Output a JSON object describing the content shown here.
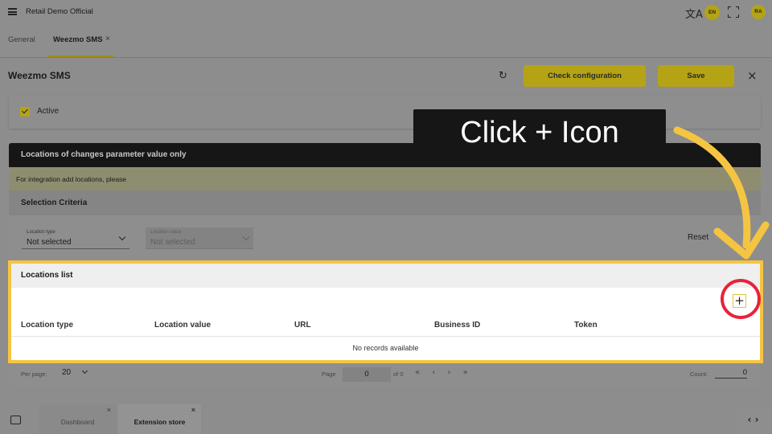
{
  "topbar": {
    "app_title": "Retail Demo Official",
    "translate_icon": "translate-icon",
    "language": "EN",
    "user_initials": "RA"
  },
  "tabs": [
    {
      "label": "General"
    },
    {
      "label": "Weezmo SMS",
      "active": true,
      "close": "×"
    }
  ],
  "header": {
    "title": "Weezmo SMS",
    "check_button": "Check configuration",
    "save_button": "Save",
    "close": "×"
  },
  "active_card": {
    "label": "Active",
    "checked": true
  },
  "locations_section": {
    "title": "Locations of changes parameter value only",
    "info": "For integration add locations, please",
    "selection_criteria": "Selection Criteria",
    "location_type": {
      "label": "Location type",
      "value": "Not selected"
    },
    "location_value": {
      "label": "Location value",
      "value": "Not selected",
      "disabled": true
    },
    "reset": "Reset"
  },
  "locations_list": {
    "title": "Locations list",
    "add_icon": "+",
    "columns": [
      "Location type",
      "Location value",
      "URL",
      "Business ID",
      "Token"
    ],
    "empty_text": "No records available"
  },
  "pager": {
    "per_page_label": "Per page:",
    "per_page": "20",
    "page_label": "Page",
    "page": "0",
    "of_label": "of 0",
    "nav": "« ‹ › »",
    "count_label": "Count:",
    "count": "0"
  },
  "taskbar": {
    "tabs": [
      {
        "label": "Dashboard",
        "close": "×"
      },
      {
        "label": "Extension store",
        "active": true,
        "close": "×"
      }
    ],
    "nav": "‹ ›"
  },
  "overlay": {
    "callout": "Click + Icon",
    "arrow_color": "#f5c542",
    "ring_color": "#e8223c"
  },
  "colors": {
    "accent": "#b5a316",
    "highlight_border": "#f5c542",
    "dark_header": "#161616"
  }
}
